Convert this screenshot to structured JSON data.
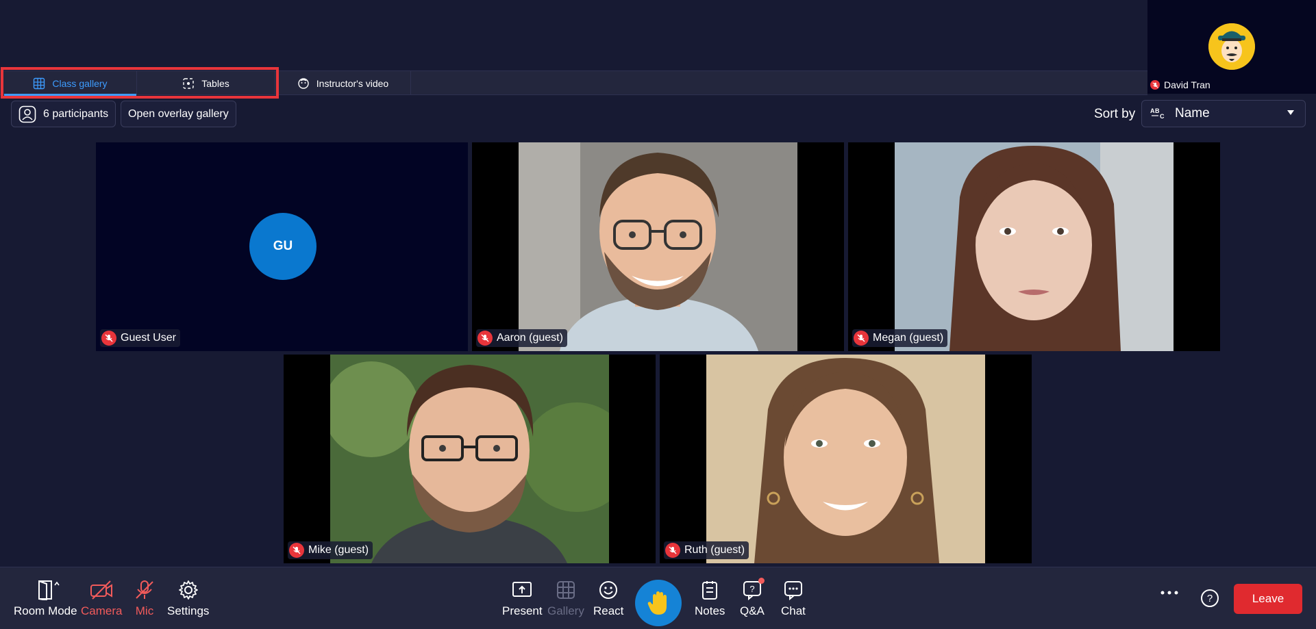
{
  "self_view": {
    "name": "David Tran"
  },
  "tabs": [
    {
      "label": "Class gallery",
      "icon": "globe-icon",
      "active": true
    },
    {
      "label": "Tables",
      "icon": "tables-icon",
      "active": false
    },
    {
      "label": "Instructor's video",
      "icon": "face-icon",
      "active": false
    }
  ],
  "controls": {
    "participants_label": "6 participants",
    "overlay_label": "Open overlay gallery",
    "sort_label": "Sort by",
    "sort_value": "Name"
  },
  "tiles": [
    {
      "name": "Guest User",
      "initials": "GU",
      "muted": true
    },
    {
      "name": "Aaron (guest)",
      "muted": true
    },
    {
      "name": "Megan (guest)",
      "muted": true
    },
    {
      "name": "Mike (guest)",
      "muted": true
    },
    {
      "name": "Ruth (guest)",
      "muted": true
    }
  ],
  "toolbar": {
    "room_mode": "Room Mode",
    "camera": "Camera",
    "mic": "Mic",
    "settings": "Settings",
    "present": "Present",
    "gallery": "Gallery",
    "react": "React",
    "notes": "Notes",
    "qa": "Q&A",
    "chat": "Chat",
    "leave": "Leave"
  },
  "colors": {
    "background": "#171a33",
    "accent": "#3d9cff",
    "danger": "#e02a2f",
    "raise_hand": "#1583d6",
    "highlight": "#e8353b"
  }
}
